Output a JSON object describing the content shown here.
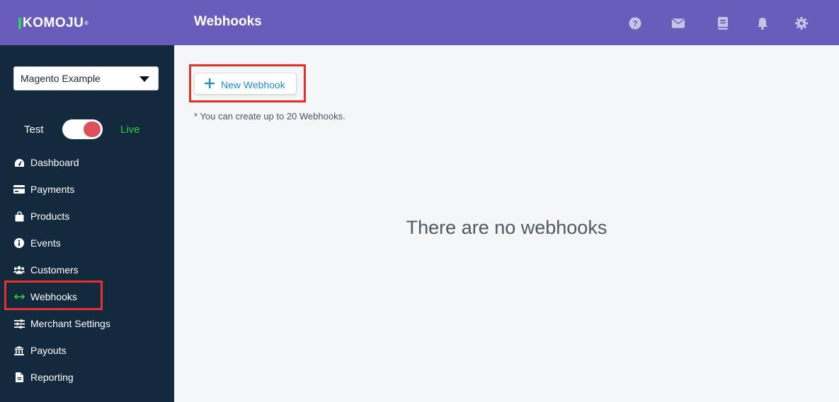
{
  "app": {
    "logo_text": "KOMOJU",
    "page_title": "Webhooks"
  },
  "header_icons": [
    "help-icon",
    "mail-icon",
    "book-icon",
    "bell-icon",
    "gear-icon"
  ],
  "sidebar": {
    "merchant_select_value": "Magento Example",
    "mode_test_label": "Test",
    "mode_live_label": "Live",
    "items": [
      {
        "label": "Dashboard",
        "icon": "dashboard-icon"
      },
      {
        "label": "Payments",
        "icon": "credit-card-icon"
      },
      {
        "label": "Products",
        "icon": "shopping-bag-icon"
      },
      {
        "label": "Events",
        "icon": "info-icon"
      },
      {
        "label": "Customers",
        "icon": "users-icon"
      },
      {
        "label": "Webhooks",
        "icon": "arrows-horizontal-icon"
      },
      {
        "label": "Merchant Settings",
        "icon": "sliders-icon"
      },
      {
        "label": "Payouts",
        "icon": "bank-icon"
      },
      {
        "label": "Reporting",
        "icon": "file-icon"
      }
    ]
  },
  "main": {
    "new_webhook_label": "New Webhook",
    "limit_note": "* You can create up to 20 Webhooks.",
    "empty_message": "There are no webhooks"
  },
  "colors": {
    "header_bg": "#6a5cba",
    "sidebar_bg": "#132a3e",
    "live_green": "#2ecc40",
    "toggle_red": "#e0505a",
    "link_blue": "#1f8ec6",
    "annotation_red": "#e8302a"
  }
}
